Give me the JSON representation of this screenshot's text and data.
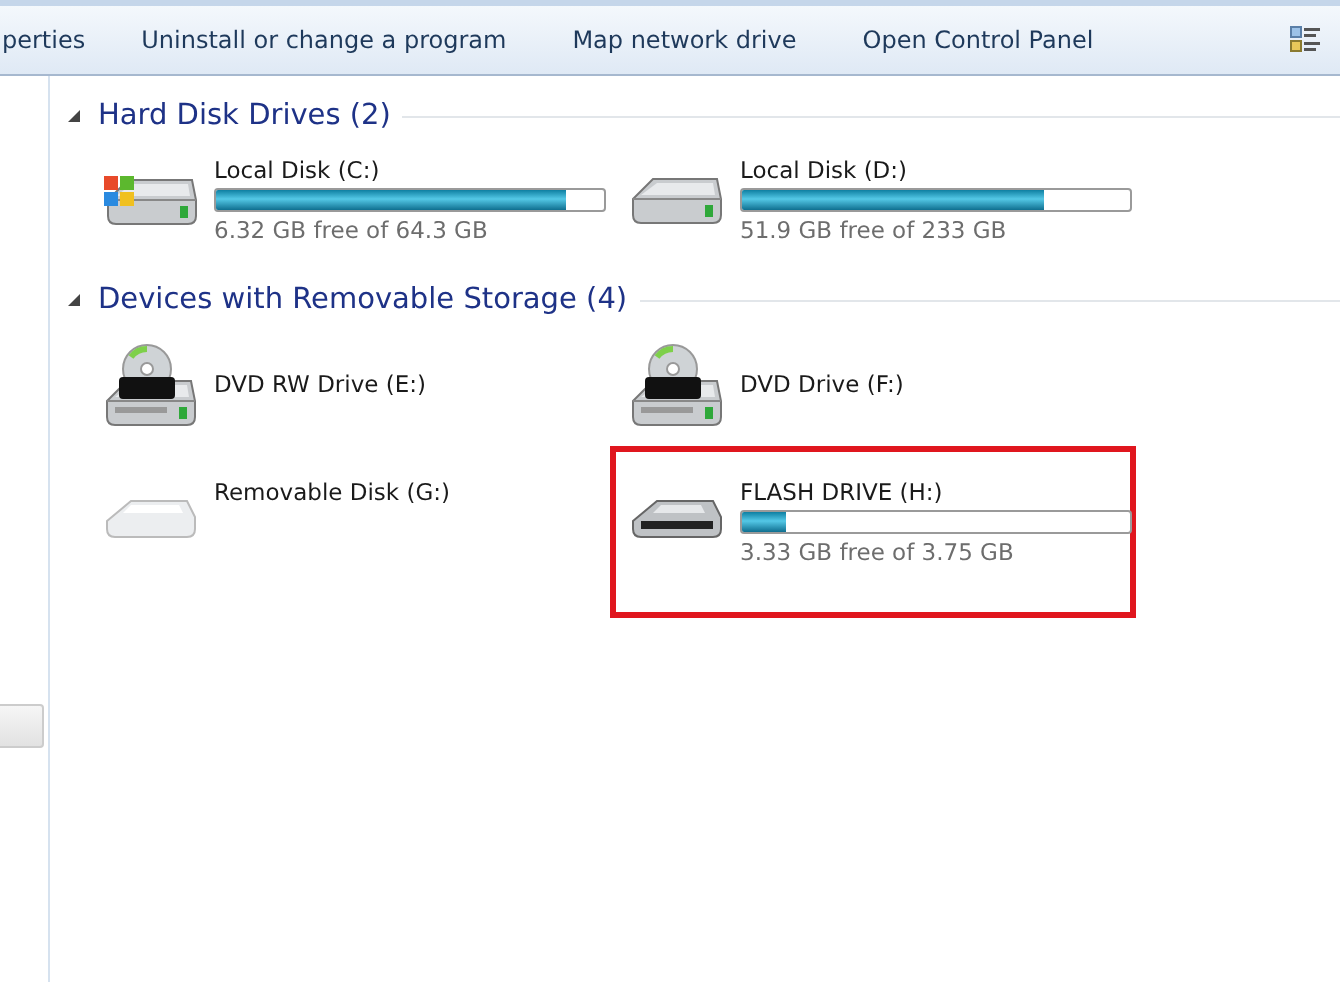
{
  "toolbar": {
    "items": [
      {
        "label": "perties"
      },
      {
        "label": "Uninstall or change a program"
      },
      {
        "label": "Map network drive"
      },
      {
        "label": "Open Control Panel"
      }
    ]
  },
  "groups": [
    {
      "title": "Hard Disk Drives (2)",
      "expanded": true,
      "drives": [
        {
          "kind": "windows-disk",
          "name": "Local Disk (C:)",
          "level": 0.902,
          "free": "6.32 GB free of 64.3 GB",
          "highlighted": false
        },
        {
          "kind": "disk",
          "name": "Local Disk (D:)",
          "level": 0.777,
          "free": "51.9 GB free of 233 GB",
          "highlighted": false
        }
      ]
    },
    {
      "title": "Devices with Removable Storage (4)",
      "expanded": true,
      "drives": [
        {
          "kind": "dvd",
          "name": "DVD RW Drive (E:)",
          "highlighted": false
        },
        {
          "kind": "dvd",
          "name": "DVD Drive (F:)",
          "highlighted": false
        },
        {
          "kind": "removable",
          "name": "Removable Disk (G:)",
          "highlighted": false
        },
        {
          "kind": "flash",
          "name": "FLASH DRIVE (H:)",
          "level": 0.112,
          "free": "3.33 GB free of 3.75 GB",
          "highlighted": true
        }
      ]
    }
  ]
}
